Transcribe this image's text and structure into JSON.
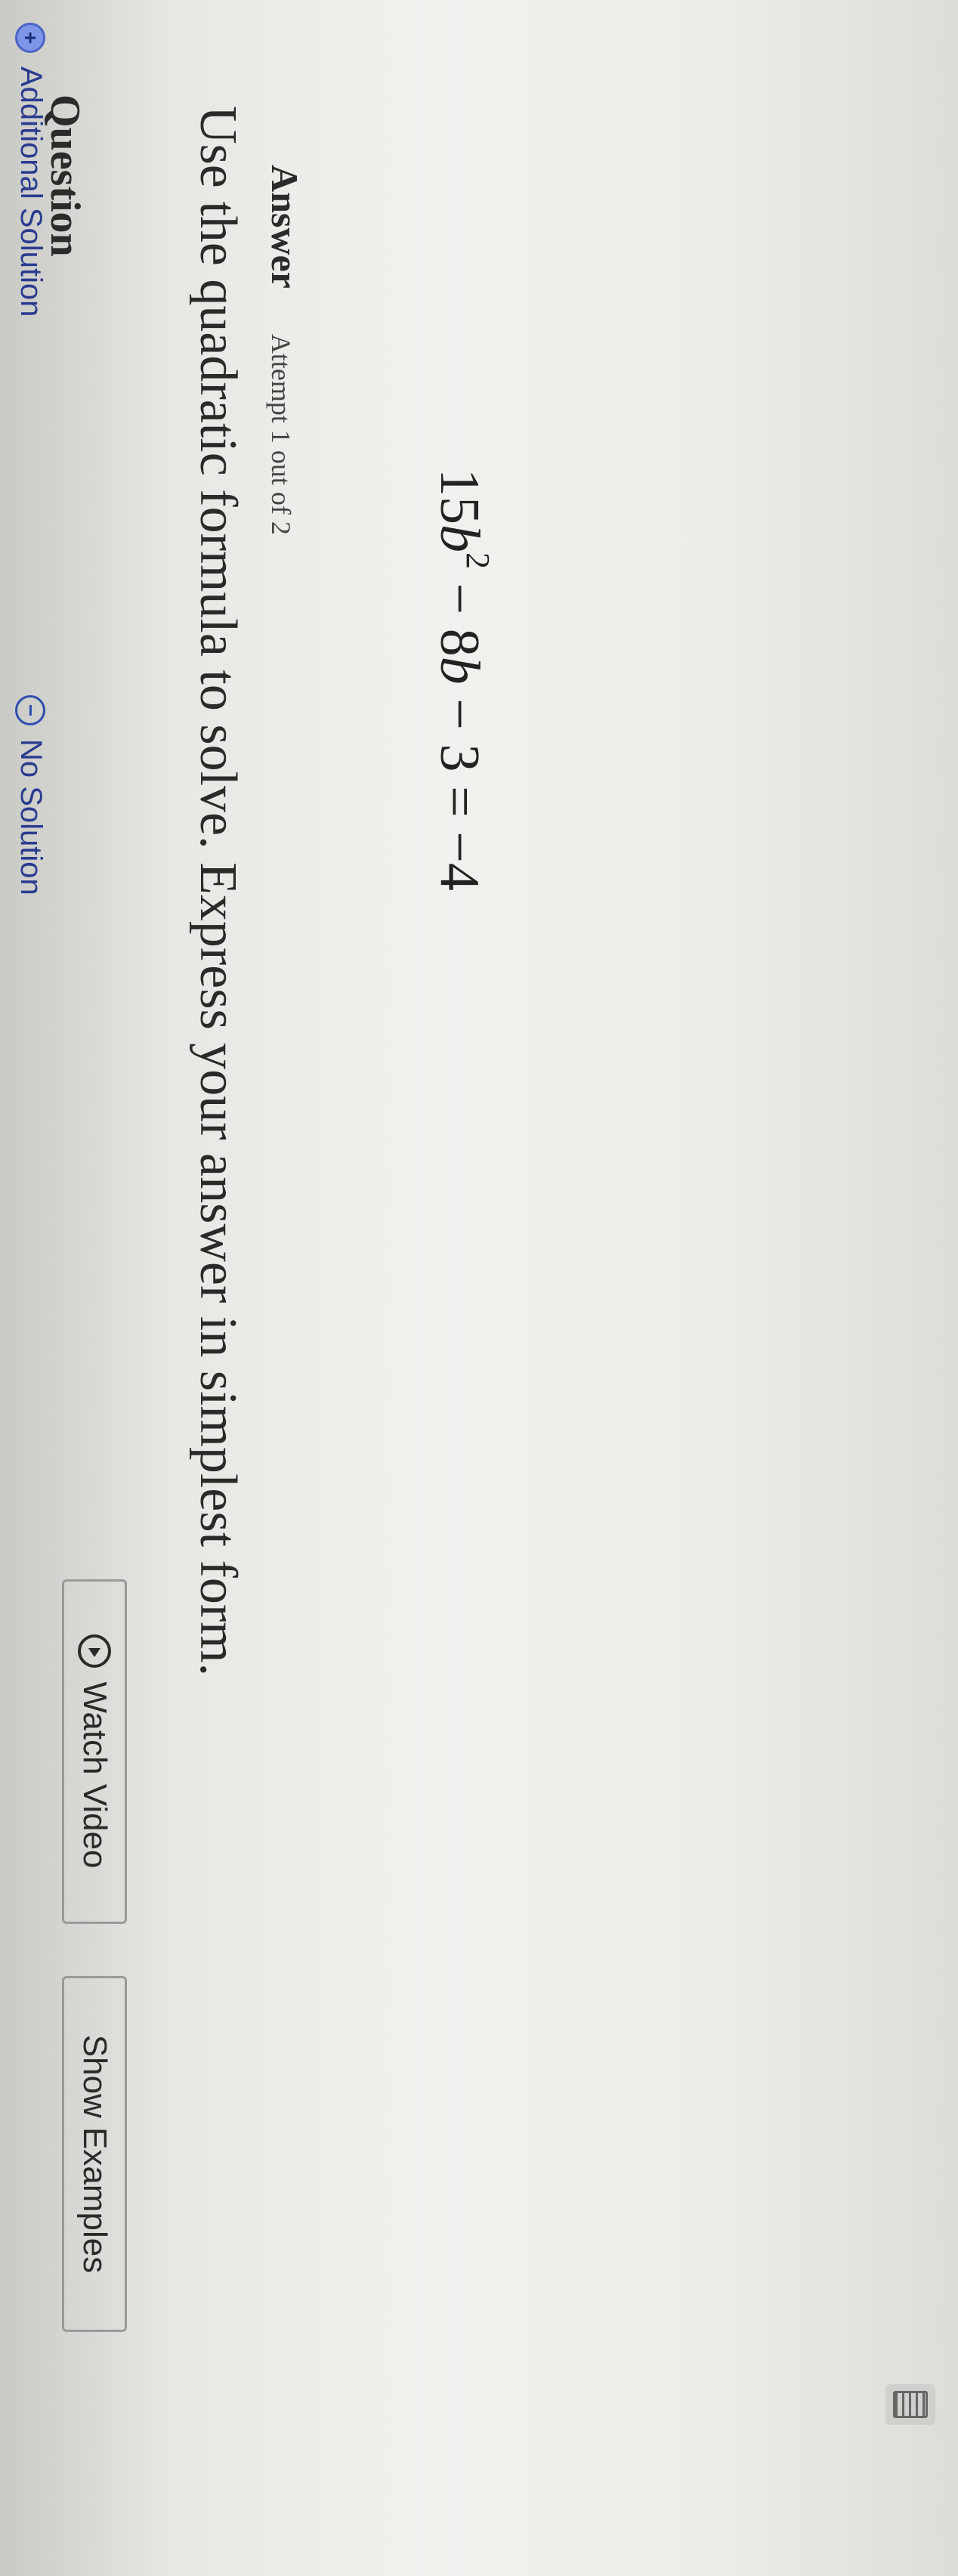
{
  "question": {
    "heading": "Question",
    "prompt": "Use the quadratic formula to solve. Express your answer in simplest form.",
    "equation": {
      "coef1": "15",
      "var1": "b",
      "exp1": "2",
      "mid": " − 8",
      "var2": "b",
      "rest": " − 3 = −4"
    }
  },
  "answer": {
    "label": "Answer",
    "attempt": "Attempt 1 out of 2"
  },
  "options": {
    "additional_symbol": "+",
    "additional_label": "Additional Solution",
    "nosolution_symbol": "−",
    "nosolution_label": "No Solution"
  },
  "buttons": {
    "watch_video": "Watch Video",
    "show_examples": "Show Examples"
  },
  "icons": [
    "play-circle-icon",
    "plus-circle-icon",
    "minus-circle-icon",
    "keyboard-icon"
  ],
  "colors": {
    "link_blue": "#2a3b8f",
    "icon_blue": "#2f4fb0"
  }
}
